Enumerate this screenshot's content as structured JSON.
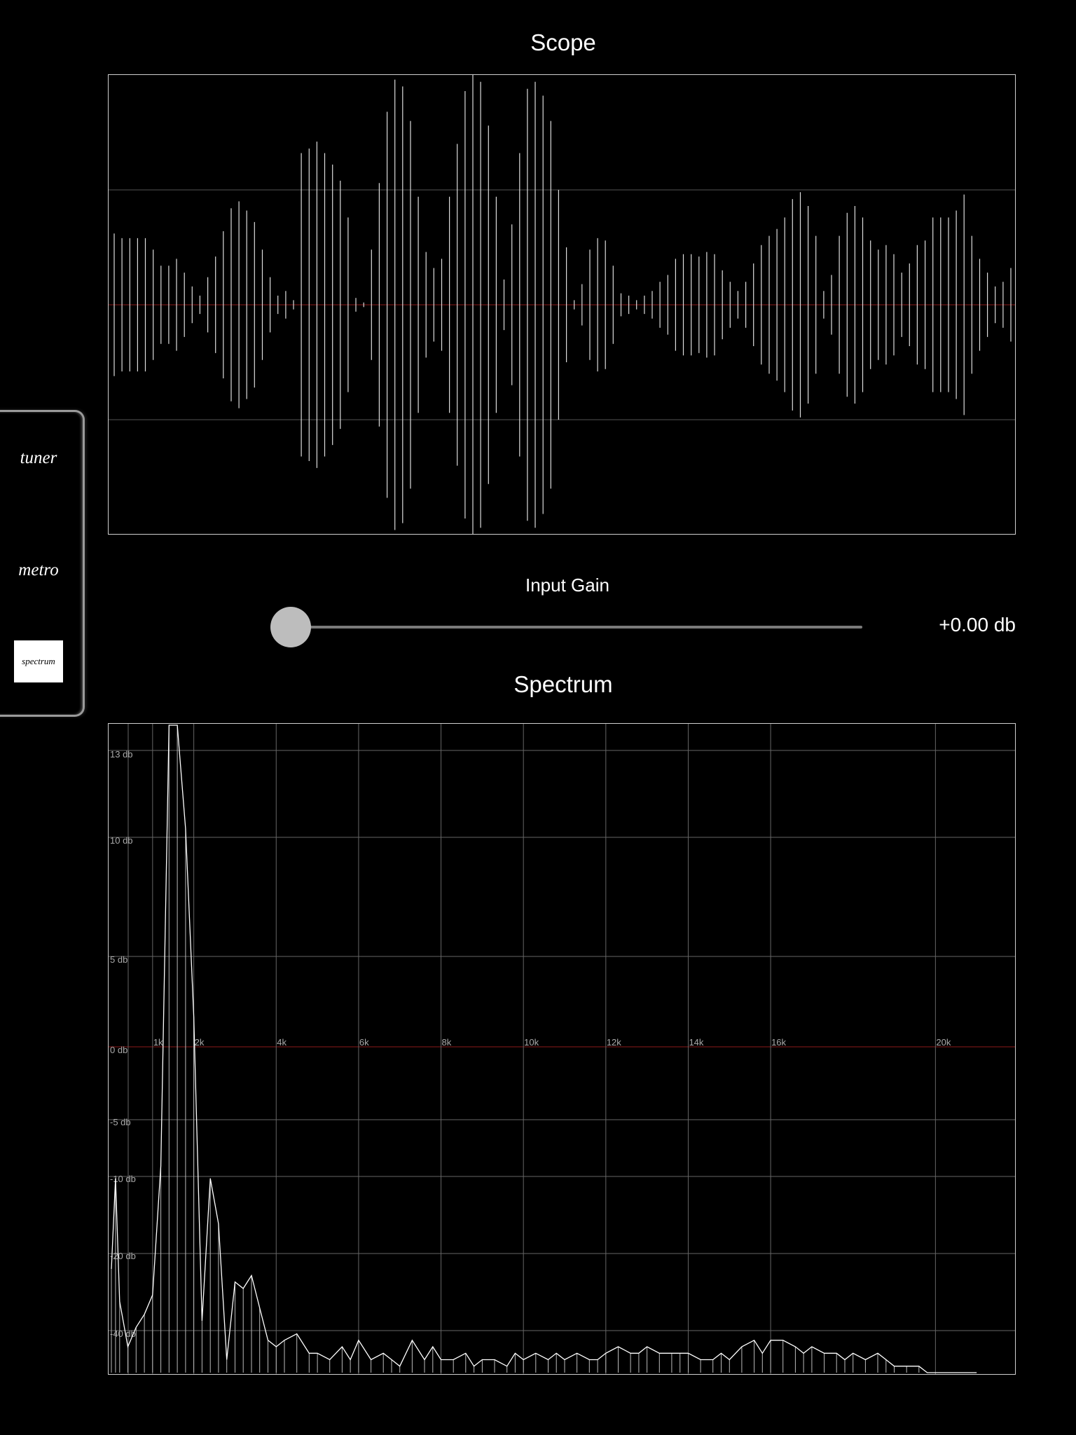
{
  "side_tabs": {
    "tuner": "tuner",
    "metro": "metro",
    "spectrum": "spectrum",
    "selected": "spectrum"
  },
  "scope": {
    "title": "Scope"
  },
  "gain": {
    "label": "Input Gain",
    "value_text": "+0.00 db",
    "value": 0.0
  },
  "spectrum": {
    "title": "Spectrum"
  },
  "colors": {
    "background": "#000000",
    "trace": "#ffffff",
    "grid": "#666666",
    "zero_line": "#8b1a1a",
    "selected_tab_bg": "#ffffff"
  },
  "chart_data": [
    {
      "type": "line",
      "title": "Scope",
      "ylim": [
        -1,
        1
      ],
      "grid": true,
      "note_amplitudes": [
        0.31,
        0.29,
        0.29,
        0.29,
        0.29,
        0.24,
        0.17,
        0.17,
        0.2,
        0.14,
        0.08,
        0.04,
        0.12,
        0.21,
        0.32,
        0.42,
        0.45,
        0.41,
        0.36,
        0.24,
        0.12,
        0.04,
        0.06,
        0.02,
        0.66,
        0.68,
        0.71,
        0.66,
        0.61,
        0.54,
        0.38,
        0.03,
        0.01,
        0.24,
        0.53,
        0.84,
        0.98,
        0.95,
        0.8,
        0.47,
        0.23,
        0.16,
        0.2,
        0.47,
        0.7,
        0.93,
        1.05,
        0.97,
        0.78,
        0.47,
        0.11,
        0.35,
        0.66,
        0.94,
        0.97,
        0.91,
        0.8,
        0.5,
        0.25,
        0.02,
        0.09,
        0.24,
        0.29,
        0.28,
        0.17,
        0.05,
        0.04,
        0.02,
        0.04,
        0.06,
        0.1,
        0.13,
        0.2,
        0.22,
        0.22,
        0.21,
        0.23,
        0.22,
        0.15,
        0.1,
        0.06,
        0.1,
        0.18,
        0.26,
        0.3,
        0.33,
        0.38,
        0.46,
        0.49,
        0.43,
        0.3,
        0.06,
        0.13,
        0.3,
        0.4,
        0.43,
        0.38,
        0.28,
        0.24,
        0.26,
        0.22,
        0.14,
        0.18,
        0.26,
        0.28,
        0.38,
        0.38,
        0.38,
        0.41,
        0.48,
        0.3,
        0.2,
        0.14,
        0.08,
        0.1,
        0.16
      ]
    },
    {
      "type": "line",
      "title": "Spectrum",
      "xlabel": "",
      "ylabel": "",
      "x_tick_labels": [
        "1k",
        "2k",
        "4k",
        "6k",
        "8k",
        "10k",
        "12k",
        "14k",
        "16k",
        "20k"
      ],
      "y_tick_labels": [
        "13 db",
        "10 db",
        "5 db",
        "0 db",
        "-5 db",
        "-10 db",
        "-20 db",
        "-40 db"
      ],
      "xlim": [
        0,
        22000
      ],
      "grid": true,
      "x": [
        0,
        100,
        200,
        400,
        600,
        800,
        1000,
        1200,
        1400,
        1600,
        1800,
        2000,
        2200,
        2400,
        2600,
        2800,
        3000,
        3200,
        3400,
        3600,
        3800,
        4000,
        4200,
        4500,
        4800,
        5000,
        5300,
        5600,
        5800,
        6000,
        6300,
        6600,
        6800,
        7000,
        7300,
        7600,
        7800,
        8000,
        8300,
        8600,
        8800,
        9000,
        9300,
        9600,
        9800,
        10000,
        10300,
        10600,
        10800,
        11000,
        11300,
        11600,
        11800,
        12000,
        12300,
        12600,
        12800,
        13000,
        13300,
        13600,
        13800,
        14000,
        14300,
        14600,
        14800,
        15000,
        15300,
        15600,
        15800,
        16000,
        16300,
        16600,
        16800,
        17000,
        17300,
        17600,
        17800,
        18000,
        18300,
        18600,
        18800,
        19000,
        19300,
        19600,
        19800,
        20000,
        20300,
        20600,
        20800,
        21000
      ],
      "y_pos": [
        0.16,
        0.3,
        0.11,
        0.04,
        0.07,
        0.09,
        0.12,
        0.32,
        1.0,
        1.0,
        0.84,
        0.55,
        0.08,
        0.3,
        0.23,
        0.02,
        0.14,
        0.13,
        0.15,
        0.1,
        0.05,
        0.04,
        0.05,
        0.06,
        0.03,
        0.03,
        0.02,
        0.04,
        0.02,
        0.05,
        0.02,
        0.03,
        0.02,
        0.01,
        0.05,
        0.02,
        0.04,
        0.02,
        0.02,
        0.03,
        0.01,
        0.02,
        0.02,
        0.01,
        0.03,
        0.02,
        0.03,
        0.02,
        0.03,
        0.02,
        0.03,
        0.02,
        0.02,
        0.03,
        0.04,
        0.03,
        0.03,
        0.04,
        0.03,
        0.03,
        0.03,
        0.03,
        0.02,
        0.02,
        0.03,
        0.02,
        0.04,
        0.05,
        0.03,
        0.05,
        0.05,
        0.04,
        0.03,
        0.04,
        0.03,
        0.03,
        0.02,
        0.03,
        0.02,
        0.03,
        0.02,
        0.01,
        0.01,
        0.01,
        0.0,
        0.0,
        0.0,
        0.0,
        0.0,
        0.0
      ]
    }
  ]
}
